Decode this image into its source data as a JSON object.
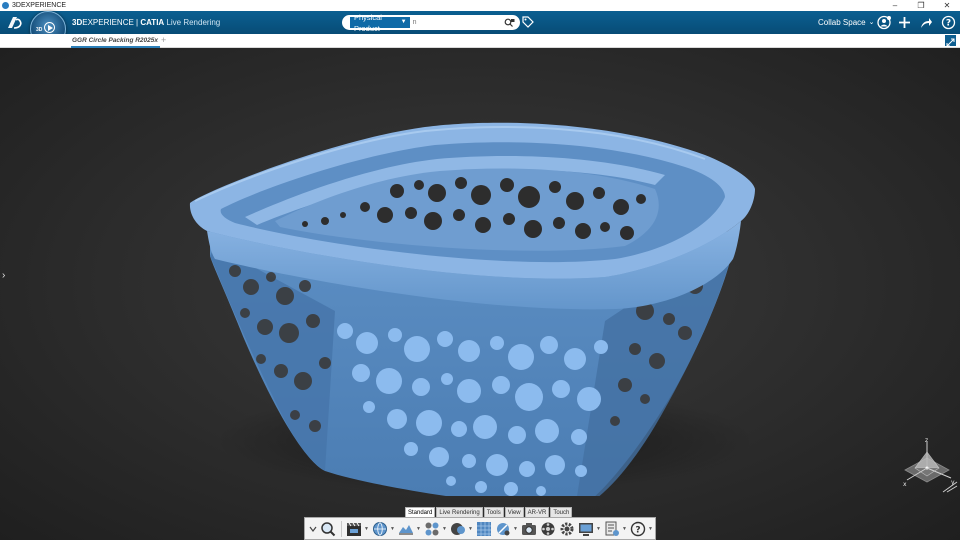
{
  "window": {
    "title": "3DEXPERIENCE",
    "minimize": "–",
    "maximize": "❐",
    "close": "✕"
  },
  "header": {
    "brand_bold": "3D",
    "brand_mid": "EXPERIENCE",
    "brand_sep": " | ",
    "brand_app": "CATIA",
    "brand_role": " Live Rendering",
    "search_scope": "Physical Product",
    "search_placeholder": "n",
    "collab_space": "Collab Space",
    "compass_label": "3D",
    "compass_version": "V,R"
  },
  "tabs": [
    {
      "label": "GGR Circle Packing R2025x",
      "active": true
    }
  ],
  "tab_add": "+",
  "viewport": {
    "left_arrow": "›",
    "model_color": "#6b9fd4",
    "background_color": "#2d2d2d"
  },
  "action_tabs": [
    {
      "label": "Standard",
      "active": true
    },
    {
      "label": "Live Rendering",
      "active": false
    },
    {
      "label": "Tools",
      "active": false
    },
    {
      "label": "View",
      "active": false
    },
    {
      "label": "AR-VR",
      "active": false
    },
    {
      "label": "Touch",
      "active": false
    }
  ],
  "compass_axes": {
    "z": "z",
    "x": "x",
    "y": "y"
  },
  "icons": {
    "accent": "#0b5f91",
    "search": "search-icon",
    "tag": "tag-icon",
    "user": "user-icon",
    "add": "plus-icon",
    "share": "share-icon",
    "help": "help-icon"
  }
}
